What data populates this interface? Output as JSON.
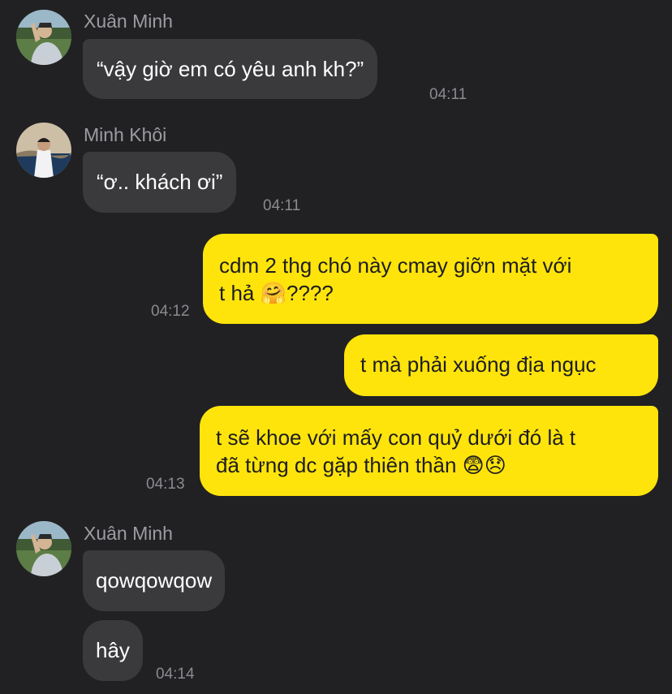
{
  "messages": [
    {
      "sender": "Xuân Minh",
      "text": "“vậy giờ em có yêu anh kh?”",
      "time": "04:11"
    },
    {
      "sender": "Minh Khôi",
      "text": "“ơ.. khách ơi”",
      "time": "04:11"
    },
    {
      "text_line1": "cdm 2 thg chó này cmay giỡn mặt với",
      "text_line2": "t hả",
      "text_line2_suffix": "????",
      "emoji": "🤗",
      "time": "04:12"
    },
    {
      "text": "t mà phải xuống địa ngục"
    },
    {
      "text_line1": "t sẽ khoe với mấy con quỷ dưới đó là t",
      "text_line2": "đã từng dc gặp thiên thần",
      "emoji1": "😨",
      "emoji2": "😞",
      "time": "04:13"
    },
    {
      "sender": "Xuân Minh",
      "text": "qowqowqow"
    },
    {
      "text": "hây",
      "time": "04:14"
    }
  ],
  "colors": {
    "background": "#212124",
    "incoming_bubble": "#3a3a3d",
    "outgoing_bubble": "#ffe40b",
    "timestamp": "#8a8a8f",
    "sender_name": "#9c9ca1"
  }
}
